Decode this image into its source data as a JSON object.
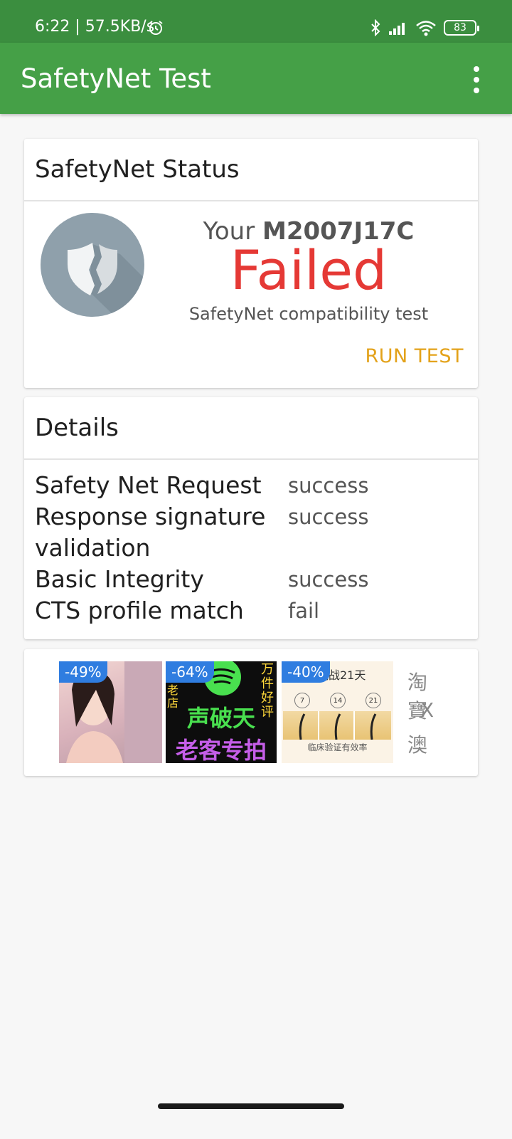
{
  "status_bar": {
    "time": "6:22 | 57.5KB/s",
    "battery": "83"
  },
  "app_bar": {
    "title": "SafetyNet Test"
  },
  "status_card": {
    "heading": "SafetyNet Status",
    "your_prefix": "Your",
    "device": "M2007J17C",
    "result": "Failed",
    "subtitle": "SafetyNet compatibility test",
    "run_test_label": "RUN TEST",
    "colors": {
      "result": "#e53935",
      "run_test": "#e3a21a"
    }
  },
  "details_card": {
    "heading": "Details",
    "rows": [
      {
        "label": "Safety Net Request",
        "value": "success"
      },
      {
        "label": "Response signature validation",
        "value": "success"
      },
      {
        "label": "Basic Integrity",
        "value": "success"
      },
      {
        "label": "CTS profile match",
        "value": "fail"
      }
    ]
  },
  "ad_banner": {
    "tiles": [
      {
        "badge": "-49%"
      },
      {
        "badge": "-64%",
        "line1": "声破天",
        "line2": "老客专拍",
        "side": "万件好评",
        "store": "老店"
      },
      {
        "badge": "-40%",
        "head": "挑战21天",
        "icons": [
          "7",
          "14",
          "21"
        ],
        "foot": "临床验证有效率"
      },
      {
        "lines": [
          "淘寶",
          "X",
          "澳門"
        ]
      }
    ]
  },
  "theme": {
    "status_bar_color": "#3b8e3f",
    "app_bar_color": "#45a047"
  }
}
